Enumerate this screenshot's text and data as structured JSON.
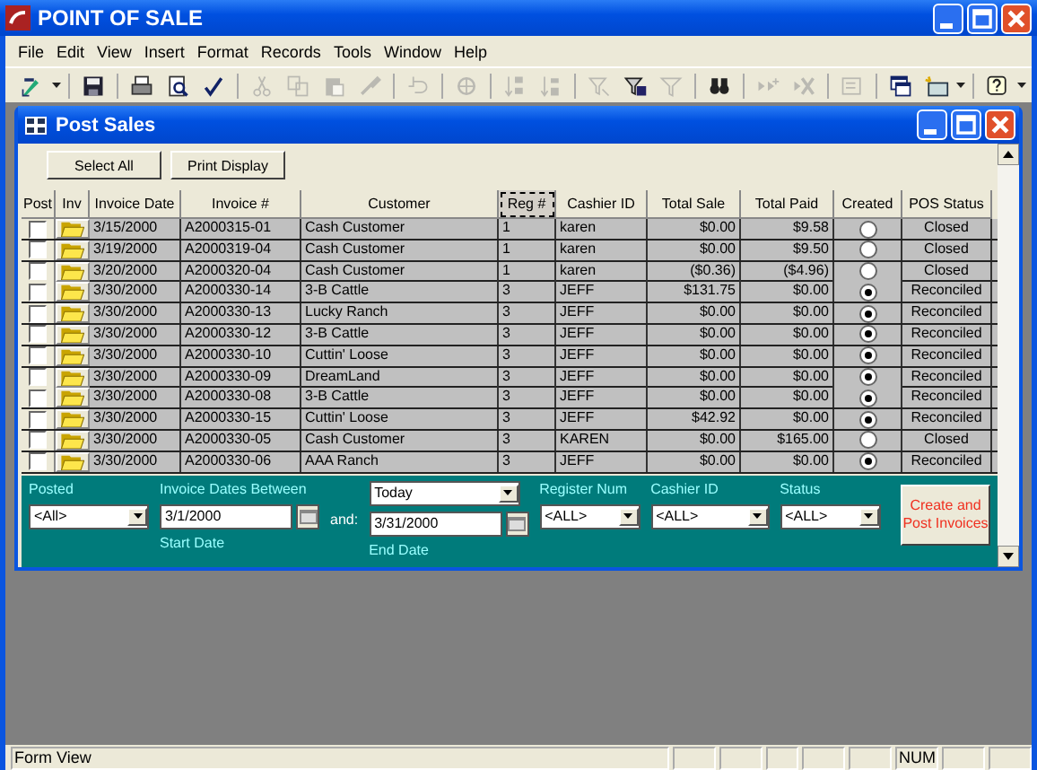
{
  "window": {
    "title": "POINT OF SALE"
  },
  "menu": [
    "File",
    "Edit",
    "View",
    "Insert",
    "Format",
    "Records",
    "Tools",
    "Window",
    "Help"
  ],
  "toolbar": [
    {
      "kind": "design",
      "disabled": false
    },
    {
      "kind": "save",
      "disabled": false
    },
    {
      "kind": "print",
      "disabled": false
    },
    {
      "kind": "preview",
      "disabled": false
    },
    {
      "kind": "spelling",
      "disabled": false
    },
    {
      "kind": "cut",
      "disabled": true
    },
    {
      "kind": "copy",
      "disabled": true
    },
    {
      "kind": "paste",
      "disabled": true
    },
    {
      "kind": "brush",
      "disabled": true
    },
    {
      "kind": "undo",
      "disabled": true
    },
    {
      "kind": "globe",
      "disabled": true
    },
    {
      "kind": "sort-asc",
      "disabled": true
    },
    {
      "kind": "sort-desc",
      "disabled": true
    },
    {
      "kind": "filter-selection",
      "disabled": true
    },
    {
      "kind": "filter-form",
      "disabled": false
    },
    {
      "kind": "filter",
      "disabled": true
    },
    {
      "kind": "find",
      "disabled": false
    },
    {
      "kind": "new-record",
      "disabled": true
    },
    {
      "kind": "delete-record",
      "disabled": true
    },
    {
      "kind": "properties",
      "disabled": true
    },
    {
      "kind": "windows",
      "disabled": false
    },
    {
      "kind": "new-object",
      "disabled": false
    },
    {
      "kind": "help",
      "disabled": false
    }
  ],
  "form": {
    "title": "Post Sales",
    "buttons": [
      "Select All",
      "Print Display"
    ],
    "columns": [
      "Post",
      "Inv",
      "Invoice Date",
      "Invoice #",
      "Customer",
      "Reg #",
      "Cashier ID",
      "Total Sale",
      "Total Paid",
      "Created",
      "POS Status"
    ],
    "rows": [
      {
        "post": false,
        "date": "3/15/2000",
        "invoice": "A2000315-01",
        "customer": "Cash Customer",
        "reg": "1",
        "cashier": "karen",
        "total_sale": "$0.00",
        "total_paid": "$9.58",
        "created": false,
        "status": "Closed"
      },
      {
        "post": false,
        "date": "3/19/2000",
        "invoice": "A2000319-04",
        "customer": "Cash Customer",
        "reg": "1",
        "cashier": "karen",
        "total_sale": "$0.00",
        "total_paid": "$9.50",
        "created": false,
        "status": "Closed"
      },
      {
        "post": false,
        "date": "3/20/2000",
        "invoice": "A2000320-04",
        "customer": "Cash Customer",
        "reg": "1",
        "cashier": "karen",
        "total_sale": "($0.36)",
        "total_paid": "($4.96)",
        "created": false,
        "status": "Closed"
      },
      {
        "post": false,
        "date": "3/30/2000",
        "invoice": "A2000330-14",
        "customer": "3-B Cattle",
        "reg": "3",
        "cashier": "JEFF",
        "total_sale": "$131.75",
        "total_paid": "$0.00",
        "created": true,
        "status": "Reconciled"
      },
      {
        "post": false,
        "date": "3/30/2000",
        "invoice": "A2000330-13",
        "customer": "Lucky Ranch",
        "reg": "3",
        "cashier": "JEFF",
        "total_sale": "$0.00",
        "total_paid": "$0.00",
        "created": true,
        "status": "Reconciled"
      },
      {
        "post": false,
        "date": "3/30/2000",
        "invoice": "A2000330-12",
        "customer": "3-B Cattle",
        "reg": "3",
        "cashier": "JEFF",
        "total_sale": "$0.00",
        "total_paid": "$0.00",
        "created": true,
        "status": "Reconciled"
      },
      {
        "post": false,
        "date": "3/30/2000",
        "invoice": "A2000330-10",
        "customer": "Cuttin' Loose",
        "reg": "3",
        "cashier": "JEFF",
        "total_sale": "$0.00",
        "total_paid": "$0.00",
        "created": true,
        "status": "Reconciled"
      },
      {
        "post": false,
        "date": "3/30/2000",
        "invoice": "A2000330-09",
        "customer": "DreamLand",
        "reg": "3",
        "cashier": "JEFF",
        "total_sale": "$0.00",
        "total_paid": "$0.00",
        "created": true,
        "status": "Reconciled"
      },
      {
        "post": false,
        "date": "3/30/2000",
        "invoice": "A2000330-08",
        "customer": "3-B Cattle",
        "reg": "3",
        "cashier": "JEFF",
        "total_sale": "$0.00",
        "total_paid": "$0.00",
        "created": true,
        "status": "Reconciled"
      },
      {
        "post": false,
        "date": "3/30/2000",
        "invoice": "A2000330-15",
        "customer": "Cuttin' Loose",
        "reg": "3",
        "cashier": "JEFF",
        "total_sale": "$42.92",
        "total_paid": "$0.00",
        "created": true,
        "status": "Reconciled"
      },
      {
        "post": false,
        "date": "3/30/2000",
        "invoice": "A2000330-05",
        "customer": "Cash Customer",
        "reg": "3",
        "cashier": "KAREN",
        "total_sale": "$0.00",
        "total_paid": "$165.00",
        "created": false,
        "status": "Closed"
      },
      {
        "post": false,
        "date": "3/30/2000",
        "invoice": "A2000330-06",
        "customer": "AAA Ranch",
        "reg": "3",
        "cashier": "JEFF",
        "total_sale": "$0.00",
        "total_paid": "$0.00",
        "created": true,
        "status": "Reconciled"
      }
    ],
    "filters": {
      "posted": {
        "label": "Posted",
        "value": "<All>"
      },
      "dates": {
        "label": "Invoice Dates Between",
        "range": "Today",
        "start": "3/1/2000",
        "start_label": "Start Date",
        "and": "and:",
        "end": "3/31/2000",
        "end_label": "End Date"
      },
      "register": {
        "label": "Register Num",
        "value": "<ALL>"
      },
      "cashier": {
        "label": "Cashier ID",
        "value": "<ALL>"
      },
      "status": {
        "label": "Status",
        "value": "<ALL>"
      },
      "action": "Create and Post Invoices"
    }
  },
  "status_bar": {
    "mode": "Form View",
    "num": "NUM"
  }
}
